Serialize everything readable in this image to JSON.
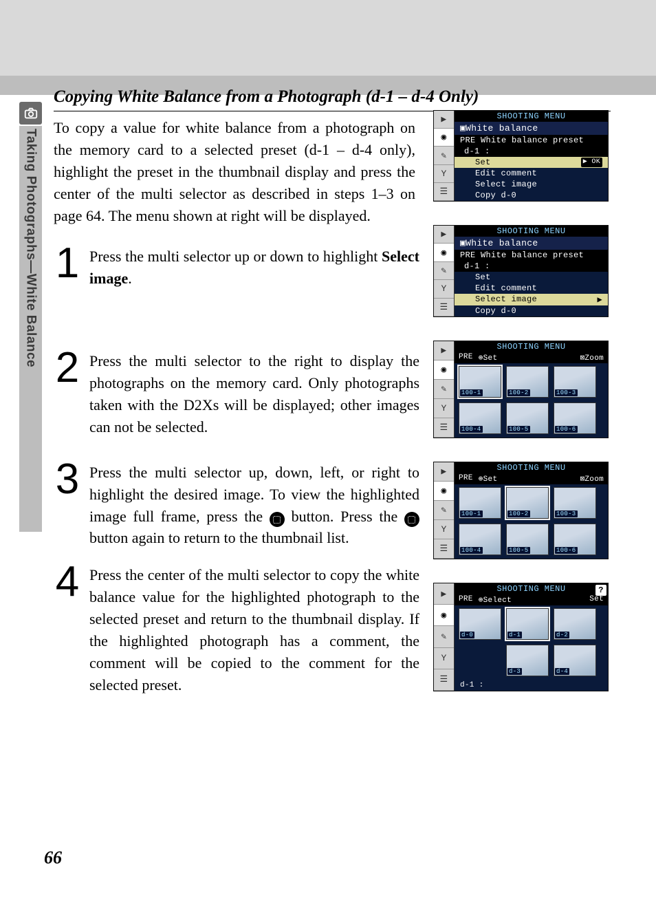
{
  "sidebar": {
    "label": "Taking Photographs—White Balance"
  },
  "section_title": "Copying White Balance from a Photograph (d-1 – d-4 Only)",
  "intro": "To copy a value for white balance from a photograph on the memory card to a selected preset (d-1 – d-4 only), highlight the preset in the thumbnail display and press the center of the multi selector as described in steps 1–3 on page 64.  The menu shown at right will be displayed.",
  "steps": [
    {
      "num": "1",
      "pre": "Press the multi selector up or down to highlight ",
      "bold": "Select image",
      "post": "."
    },
    {
      "num": "2",
      "text": "Press the multi selector to the right to display the photographs on the memory card.  Only photographs taken with the D2Xs will be displayed; other images can not be selected."
    },
    {
      "num": "3",
      "text_a": "Press the multi selector up, down, left, or right to highlight the desired image.  To view the highlighted image full frame, press the ",
      "text_b": " button.  Press the ",
      "text_c": " button again to return to the thumbnail list."
    },
    {
      "num": "4",
      "text": "Press the center of the multi selector to copy the white balance value for the highlighted photograph to the selected preset and return to the thumbnail display.  If the highlighted photograph has a comment, the comment will be copied to the comment for the selected preset."
    }
  ],
  "page_number": "66",
  "cam": {
    "title": "SHOOTING MENU",
    "wb": "White balance",
    "pre_line": "PRE  White balance preset",
    "d1": "d-1    :",
    "set": "Set",
    "edit": "Edit comment",
    "select_img": "Select image",
    "copy": "Copy d-0",
    "ok": "▶ OK",
    "arrow": "▶",
    "pre": "PRE",
    "set_icon": "⊕Set",
    "zoom_icon": "⊠Zoom",
    "select_icon": "⊕Select",
    "enter_set": "Set",
    "help": "?"
  },
  "thumbs": {
    "row1": [
      "100-1",
      "100-2",
      "100-3"
    ],
    "row2": [
      "100-4",
      "100-5",
      "100-6"
    ],
    "presets": [
      "d-0",
      "d-1",
      "d-2",
      "d-3",
      "d-4"
    ],
    "bottom_label": "d-1 :"
  }
}
